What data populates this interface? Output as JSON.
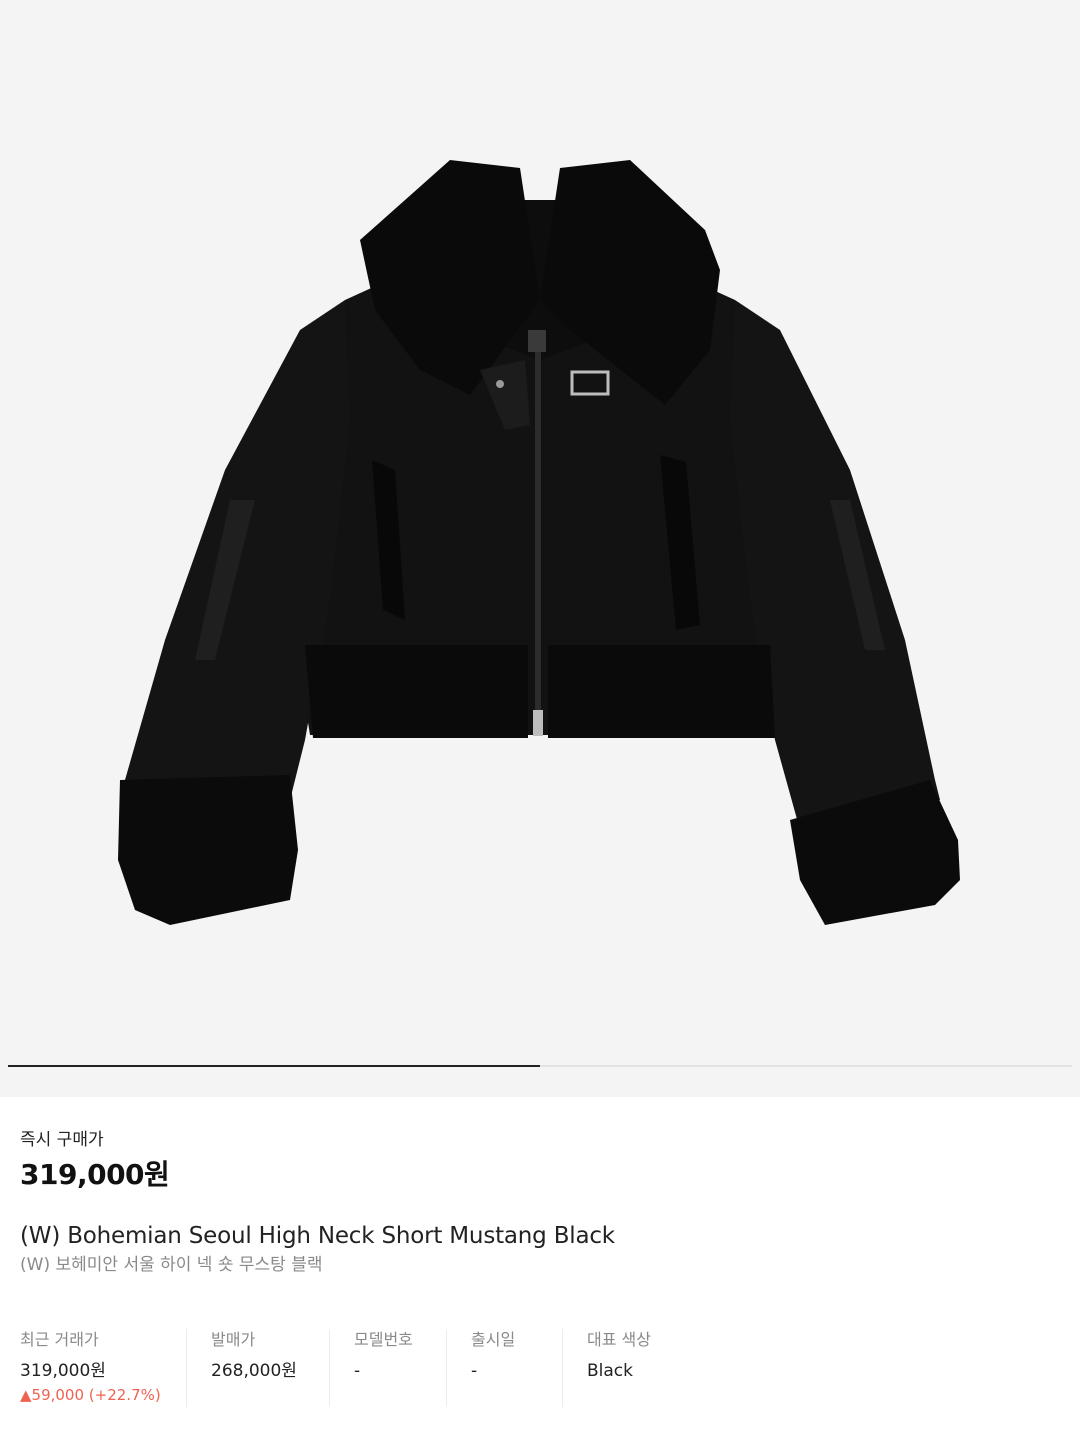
{
  "gallery": {
    "image_alt": "",
    "progress": 0.5,
    "colors": {
      "background": "#f4f4f4",
      "jacket": "#121212",
      "fur": "#0b0b0b",
      "track": "#e2e2e2",
      "fill": "#222222"
    }
  },
  "buy": {
    "label": "즉시 구매가",
    "price": "319,000원"
  },
  "product": {
    "name_en": "(W) Bohemian Seoul High Neck Short Mustang Black",
    "name_ko": "(W) 보헤미안 서울 하이 넥 숏 무스탕 블랙"
  },
  "specs": {
    "recent": {
      "label": "최근 거래가",
      "value": "319,000원",
      "change": "▲59,000 (+22.7%)"
    },
    "release_price": {
      "label": "발매가",
      "value": "268,000원"
    },
    "model": {
      "label": "모델번호",
      "value": "-"
    },
    "release_date": {
      "label": "출시일",
      "value": "-"
    },
    "color": {
      "label": "대표 색상",
      "value": "Black"
    }
  },
  "accent_colors": {
    "up": "#ef6253"
  }
}
